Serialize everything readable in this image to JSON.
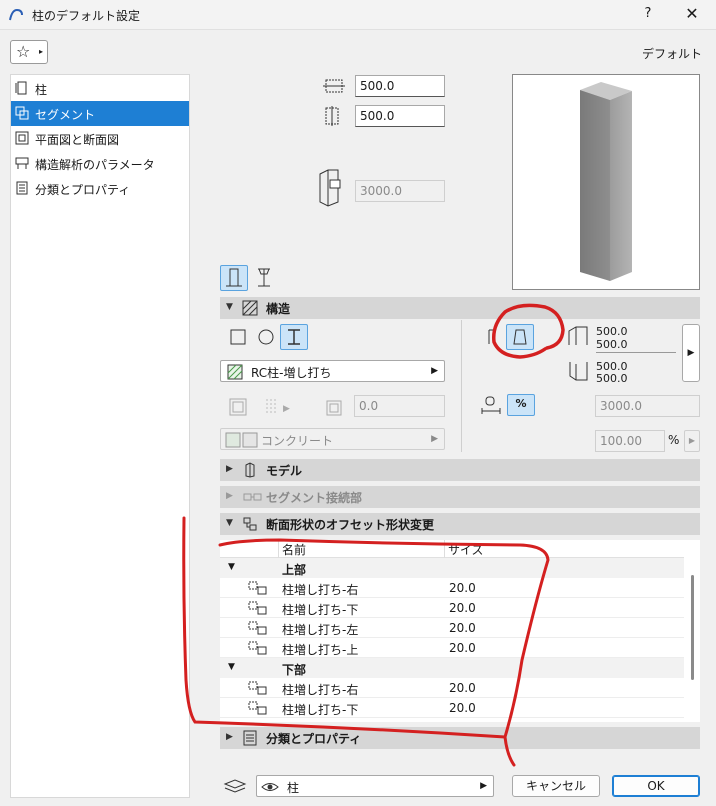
{
  "window": {
    "title": "柱のデフォルト設定",
    "help": "?",
    "close": "✕"
  },
  "toolbar": {
    "favorites_star": "☆",
    "favorites_arrow": "▸",
    "default_label": "デフォルト"
  },
  "sidebar": {
    "items": [
      {
        "label": "柱"
      },
      {
        "label": "セグメント",
        "selected": true
      },
      {
        "label": "平面図と断面図"
      },
      {
        "label": "構造解析のパラメータ"
      },
      {
        "label": "分類とプロパティ"
      }
    ]
  },
  "dimensions": {
    "width": "500.0",
    "depth": "500.0",
    "height": "3000.0"
  },
  "structure": {
    "title": "構造",
    "building_material": "RC柱-増し打ち",
    "offset_value": "0.0",
    "surface": "コンクリート",
    "top_width": "500.0",
    "top_depth": "500.0",
    "bottom_width": "500.0",
    "bottom_depth": "500.0",
    "segment_height": "3000.0",
    "percent_value": "100.00",
    "percent_unit": "%",
    "percent_toggle": "%"
  },
  "sections": {
    "model": "モデル",
    "segment_joint": "セグメント接続部",
    "offset": "断面形状のオフセット形状変更",
    "classification": "分類とプロパティ"
  },
  "offset_table": {
    "headers": {
      "name": "名前",
      "size": "サイズ"
    },
    "groups": [
      {
        "label": "上部",
        "rows": [
          {
            "name": "柱増し打ち-右",
            "size": "20.0"
          },
          {
            "name": "柱増し打ち-下",
            "size": "20.0"
          },
          {
            "name": "柱増し打ち-左",
            "size": "20.0"
          },
          {
            "name": "柱増し打ち-上",
            "size": "20.0"
          }
        ]
      },
      {
        "label": "下部",
        "rows": [
          {
            "name": "柱増し打ち-右",
            "size": "20.0"
          },
          {
            "name": "柱増し打ち-下",
            "size": "20.0"
          }
        ]
      }
    ]
  },
  "footer": {
    "layer": "柱",
    "cancel": "キャンセル",
    "ok": "OK"
  },
  "colors": {
    "accent": "#1e7fd4",
    "annotation": "#d42020",
    "selected_bg": "#cbe4f8"
  }
}
